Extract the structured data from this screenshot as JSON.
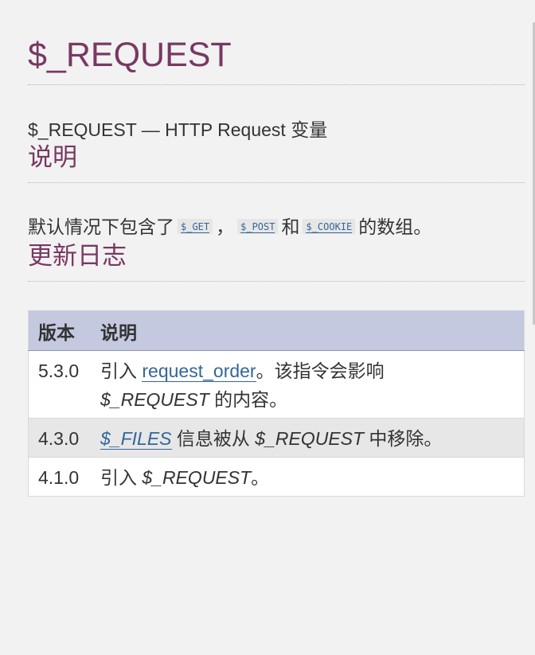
{
  "page": {
    "title": "$_REQUEST",
    "refname": "$_REQUEST — HTTP Request 变量"
  },
  "description": {
    "heading": "说明",
    "text_before": "默认情况下包含了",
    "code_get": "$_GET",
    "sep1": "，",
    "code_post": "$_POST",
    "sep2": "和",
    "code_cookie": "$_COOKIE",
    "text_after": "的数组。"
  },
  "changelog": {
    "heading": "更新日志",
    "columns": [
      "版本",
      "说明"
    ],
    "rows": [
      {
        "version": "5.3.0",
        "pre": "引入 ",
        "link": "request_order",
        "mid": "。该指令会影响",
        "var": "$_REQUEST",
        "post": " 的内容。"
      },
      {
        "version": "4.3.0",
        "link": "$_FILES",
        "mid": " 信息被从 ",
        "var": "$_REQUEST",
        "post": " 中移除。"
      },
      {
        "version": "4.1.0",
        "pre": "引入 ",
        "var": "$_REQUEST",
        "post": "。"
      }
    ]
  },
  "colors": {
    "heading": "#793862",
    "link": "#336699",
    "table_header": "#c4c9df",
    "background": "#f2f2f2"
  }
}
